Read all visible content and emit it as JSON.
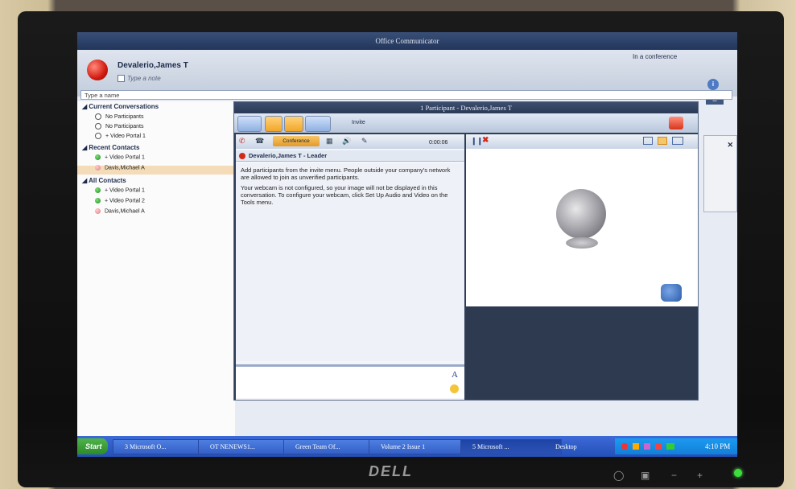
{
  "window": {
    "title": "Office Communicator",
    "status": "In a conference"
  },
  "user": {
    "name": "Devalerio,James T",
    "note_placeholder": "Type a note"
  },
  "search": {
    "placeholder": "Type a name"
  },
  "contacts": {
    "groups": [
      {
        "label": "Current Conversations",
        "items": [
          "No Participants",
          "No Participants",
          "+ Video Portal 1"
        ]
      },
      {
        "label": "Recent Contacts",
        "items": [
          "+ Video Portal 1",
          "Davis,Michael A"
        ]
      },
      {
        "label": "All Contacts",
        "items": [
          "+ Video Portal 1",
          "+ Video Portal 2",
          "Davis,Michael A"
        ]
      }
    ]
  },
  "conversation": {
    "title": "1 Participant - Devalerio,James T",
    "invite_label": "Invite",
    "conference_label": "Conference",
    "timer": "0:00:06",
    "leader": "Devalerio,James T - Leader",
    "messages": [
      "Add participants from the invite menu. People outside your company's network are allowed to join as unverified participants.",
      "Your webcam is not configured, so your image will not be displayed in this conversation. To configure your webcam, click Set Up Audio and Video on the Tools menu."
    ],
    "font_glyph": "A"
  },
  "taskbar": {
    "start": "Start",
    "tasks": [
      "3 Microsoft O...",
      "OT NENEWS1...",
      "Green Team Of...",
      "Volume 2 Issue 1",
      "5 Microsoft ..."
    ],
    "desktop": "Desktop",
    "clock": "4:10 PM"
  },
  "monitor": {
    "brand": "DELL"
  },
  "colors": {
    "frame_orange": "#e27a2c",
    "titlebar": "#22365c",
    "taskbar": "#2450b8",
    "status_busy": "#d21a10",
    "status_available": "#1c8c1c"
  }
}
